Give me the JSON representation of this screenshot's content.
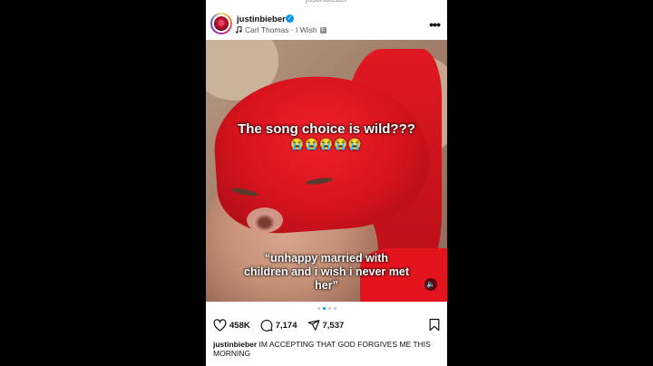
{
  "post": {
    "top_cut_text": "justinbieber",
    "username": "justinbieber",
    "verified_glyph": "✓",
    "music": "Carl Thomas · I Wish",
    "explicit_badge": "E",
    "more_glyph": "•••",
    "overlay_top": "The song choice is wild???",
    "overlay_emojis": "😭😭😭😭😭",
    "overlay_bottom": "“unhappy married with children and i wish i never met her”",
    "sound_glyph": "🔈",
    "likes": "458K",
    "comments": "7,174",
    "shares": "7,537",
    "caption_user": "justinbieber",
    "caption_text": " IM ACCEPTING THAT GOD FORGIVES ME THIS MORNING"
  },
  "carousel": {
    "count": 4,
    "active_index": 1
  },
  "icons": [
    "verified-icon",
    "music-note-icon",
    "more-icon",
    "sound-icon",
    "heart-icon",
    "comment-icon",
    "share-icon",
    "bookmark-icon"
  ],
  "colors": {
    "accent": "#0095f6",
    "hat_red": "#e01822"
  }
}
